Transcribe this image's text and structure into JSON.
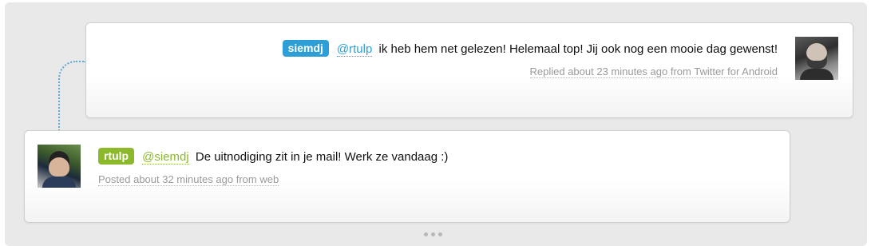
{
  "reply": {
    "username": "siemdj",
    "mention": "@rtulp",
    "text": "ik heb hem net gelezen! Helemaal top! Jij ook nog een mooie dag gewenst!",
    "meta": "Replied about 23 minutes ago from Twitter for Android"
  },
  "original": {
    "username": "rtulp",
    "mention": "@siemdj",
    "text": "De uitnodiging zit in je mail! Werk ze vandaag :)",
    "meta": "Posted about 32 minutes ago from web"
  },
  "colors": {
    "reply_accent": "#2e9fd6",
    "original_accent": "#8cb82b",
    "connector": "#5aa9d6"
  },
  "icons": {
    "more": "ellipsis-icon"
  }
}
